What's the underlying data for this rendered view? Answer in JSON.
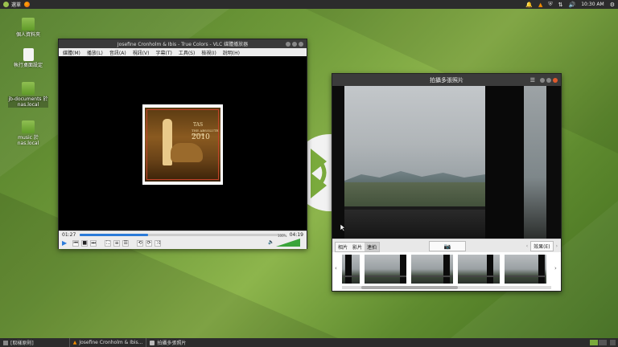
{
  "top_panel": {
    "menu_label": "選單",
    "clock": "10:30 AM"
  },
  "desktop_icons": [
    {
      "label": "個人資料夾"
    },
    {
      "label": "執行桌面設定"
    },
    {
      "label": "jb-documents 於 nas.local"
    },
    {
      "label": "music 於 nas.local"
    }
  ],
  "vlc": {
    "title": "Josefine Cronholm & Ibis - True Colors - VLC 媒體播放器",
    "menu": [
      "媒體(M)",
      "播放(L)",
      "音訊(A)",
      "視訊(V)",
      "字幕(T)",
      "工具(S)",
      "檢視(I)",
      "說明(H)"
    ],
    "time_elapsed": "01:27",
    "time_total": "04:19",
    "progress": 0.335,
    "volume_label": "100%",
    "album": {
      "line1": "TAS",
      "line2": "THE ABSOLUTE SOUND",
      "line3": "2010"
    }
  },
  "cheese": {
    "title": "拍攝多張照片",
    "modes": [
      "相片",
      "影片",
      "連拍"
    ],
    "active_mode": 2,
    "effects_label": "效果(E)"
  },
  "taskbar": {
    "tasks": [
      {
        "label": "[取樣原則]"
      },
      {
        "label": "Josefine Cronholm & Ibis..."
      },
      {
        "label": "拍攝多張照片"
      }
    ]
  },
  "colors": {
    "panel": "#2c2c2c",
    "vlc_accent": "#2b7bd9",
    "close": "#e05a2c"
  }
}
